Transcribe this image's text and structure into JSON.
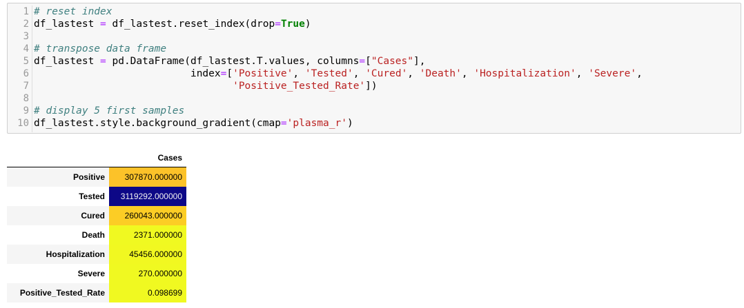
{
  "code_cell": {
    "line_numbers": [
      "1",
      "2",
      "3",
      "4",
      "5",
      "6",
      "7",
      "8",
      "9",
      "10"
    ],
    "lines": [
      [
        {
          "t": "# reset index",
          "c": "cm"
        }
      ],
      [
        {
          "t": "df_lastest ",
          "c": ""
        },
        {
          "t": "=",
          "c": "op"
        },
        {
          "t": " df_lastest.reset_index(drop",
          "c": ""
        },
        {
          "t": "=",
          "c": "op"
        },
        {
          "t": "True",
          "c": "kw"
        },
        {
          "t": ")",
          "c": ""
        }
      ],
      [],
      [
        {
          "t": "# transpose data frame",
          "c": "cm"
        }
      ],
      [
        {
          "t": "df_lastest ",
          "c": ""
        },
        {
          "t": "=",
          "c": "op"
        },
        {
          "t": " pd.DataFrame(df_lastest.T.values, columns",
          "c": ""
        },
        {
          "t": "=",
          "c": "op"
        },
        {
          "t": "[",
          "c": ""
        },
        {
          "t": "\"Cases\"",
          "c": "st"
        },
        {
          "t": "],",
          "c": ""
        }
      ],
      [
        {
          "t": "                          index",
          "c": ""
        },
        {
          "t": "=",
          "c": "op"
        },
        {
          "t": "[",
          "c": ""
        },
        {
          "t": "'Positive'",
          "c": "st"
        },
        {
          "t": ", ",
          "c": ""
        },
        {
          "t": "'Tested'",
          "c": "st"
        },
        {
          "t": ", ",
          "c": ""
        },
        {
          "t": "'Cured'",
          "c": "st"
        },
        {
          "t": ", ",
          "c": ""
        },
        {
          "t": "'Death'",
          "c": "st"
        },
        {
          "t": ", ",
          "c": ""
        },
        {
          "t": "'Hospitalization'",
          "c": "st"
        },
        {
          "t": ", ",
          "c": ""
        },
        {
          "t": "'Severe'",
          "c": "st"
        },
        {
          "t": ",",
          "c": ""
        }
      ],
      [
        {
          "t": "                                 ",
          "c": ""
        },
        {
          "t": "'Positive_Tested_Rate'",
          "c": "st"
        },
        {
          "t": "])",
          "c": ""
        }
      ],
      [],
      [
        {
          "t": "# display 5 first samples",
          "c": "cm"
        }
      ],
      [
        {
          "t": "df_lastest.style.background_gradient(cmap",
          "c": ""
        },
        {
          "t": "=",
          "c": "op"
        },
        {
          "t": "'plasma_r'",
          "c": "st"
        },
        {
          "t": ")",
          "c": ""
        }
      ]
    ]
  },
  "table": {
    "column_header": "Cases",
    "rows": [
      {
        "label": "Positive",
        "value": "307870.000000",
        "bg": "#fcc229",
        "fg": "#000000"
      },
      {
        "label": "Tested",
        "value": "3119292.000000",
        "bg": "#0d0887",
        "fg": "#f1f1f1"
      },
      {
        "label": "Cured",
        "value": "260043.000000",
        "bg": "#fccd25",
        "fg": "#000000"
      },
      {
        "label": "Death",
        "value": "2371.000000",
        "bg": "#f0f921",
        "fg": "#000000"
      },
      {
        "label": "Hospitalization",
        "value": "45456.000000",
        "bg": "#f1f821",
        "fg": "#000000"
      },
      {
        "label": "Severe",
        "value": "270.000000",
        "bg": "#f0f921",
        "fg": "#000000"
      },
      {
        "label": "Positive_Tested_Rate",
        "value": "0.098699",
        "bg": "#f0f921",
        "fg": "#000000"
      }
    ]
  }
}
